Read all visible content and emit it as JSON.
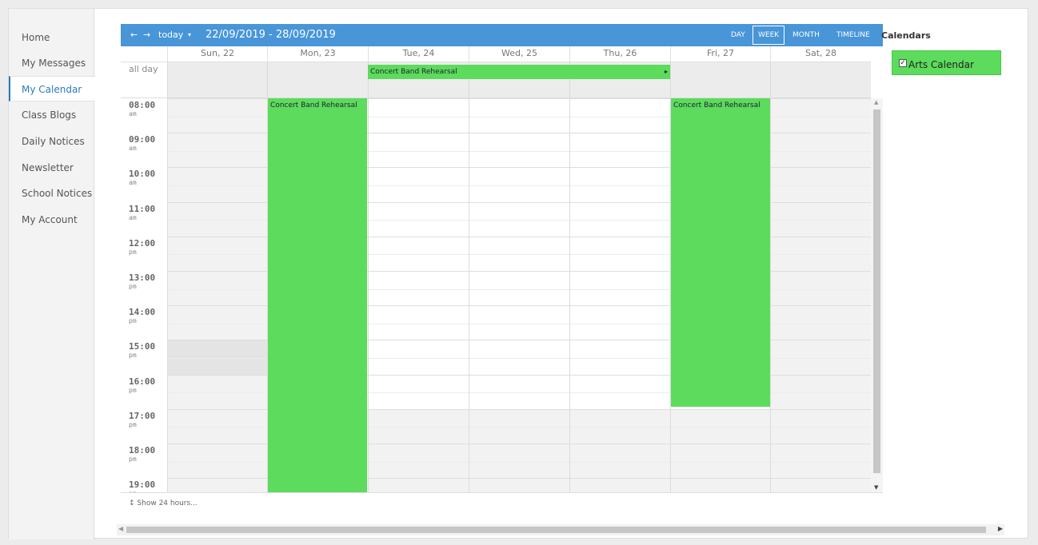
{
  "nav": {
    "items": [
      {
        "label": "Home"
      },
      {
        "label": "My Messages"
      },
      {
        "label": "My Calendar",
        "active": true
      },
      {
        "label": "Class Blogs"
      },
      {
        "label": "Daily Notices"
      },
      {
        "label": "Newsletter"
      },
      {
        "label": "School Notices"
      },
      {
        "label": "My Account"
      }
    ]
  },
  "toolbar": {
    "prev_icon": "left-arrow-icon",
    "next_icon": "right-arrow-icon",
    "today_label": "today",
    "dropdown_icon": "caret-down-icon",
    "range": "22/09/2019 - 28/09/2019",
    "views": {
      "day": "DAY",
      "week": "WEEK",
      "month": "MONTH",
      "timeline": "TIMELINE"
    },
    "active_view": "WEEK",
    "color": "#4895d8"
  },
  "days": [
    "Sun, 22",
    "Mon, 23",
    "Tue, 24",
    "Wed, 25",
    "Thu, 26",
    "Fri, 27",
    "Sat, 28"
  ],
  "allday_label": "all day",
  "hours": [
    {
      "time": "08:00",
      "ampm": "am"
    },
    {
      "time": "09:00",
      "ampm": "am"
    },
    {
      "time": "10:00",
      "ampm": "am"
    },
    {
      "time": "11:00",
      "ampm": "am"
    },
    {
      "time": "12:00",
      "ampm": "pm"
    },
    {
      "time": "13:00",
      "ampm": "pm"
    },
    {
      "time": "14:00",
      "ampm": "pm"
    },
    {
      "time": "15:00",
      "ampm": "pm"
    },
    {
      "time": "16:00",
      "ampm": "pm"
    },
    {
      "time": "17:00",
      "ampm": "pm"
    },
    {
      "time": "18:00",
      "ampm": "pm"
    },
    {
      "time": "19:00",
      "ampm": "pm"
    }
  ],
  "events": {
    "allday": {
      "title": "Concert Band Rehearsal",
      "start_day": "Tue, 24",
      "end_day": "Thu, 26"
    },
    "mon": {
      "title": "Concert Band Rehearsal",
      "day": "Mon, 23",
      "start": "08:00",
      "end": "19:30"
    },
    "fri": {
      "title": "Concert Band Rehearsal",
      "day": "Fri, 27",
      "start": "08:00",
      "end": "17:00"
    },
    "color": "#5cdb5c"
  },
  "show24_label": "Show 24 hours...",
  "calendars": {
    "title": "Calendars",
    "items": [
      {
        "label": "Arts Calendar",
        "checked": true,
        "color": "#5cdb5c"
      }
    ]
  }
}
